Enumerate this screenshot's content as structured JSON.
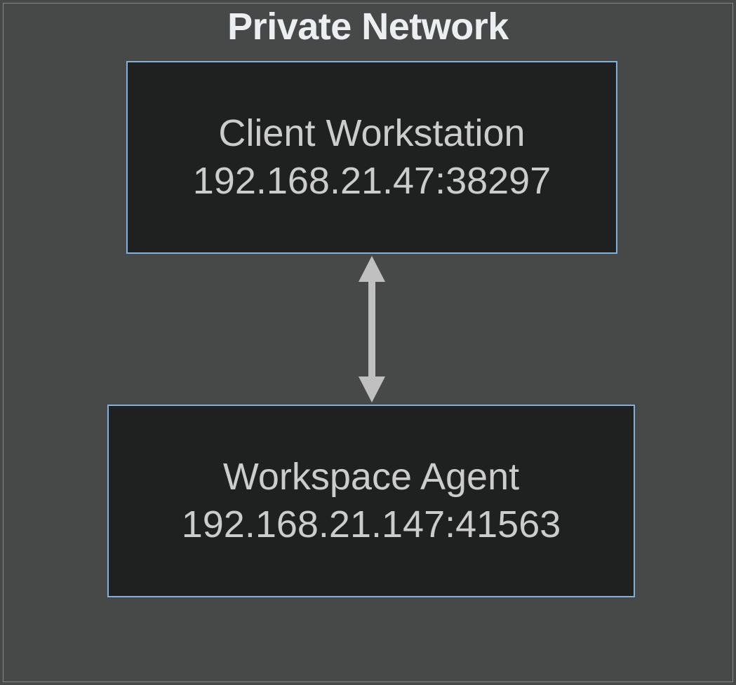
{
  "diagram": {
    "title": "Private Network",
    "nodes": {
      "client": {
        "label": "Client Workstation",
        "address": "192.168.21.47:38297"
      },
      "agent": {
        "label": "Workspace Agent",
        "address": "192.168.21.147:41563"
      }
    },
    "connection": {
      "type": "bidirectional",
      "from": "client",
      "to": "agent"
    },
    "colors": {
      "background": "#474949",
      "node_bg": "#1f2020",
      "node_border": "#81b1db",
      "text_title": "#eceff1",
      "text_node": "#cccccc",
      "arrow": "#c0c0c0"
    }
  }
}
